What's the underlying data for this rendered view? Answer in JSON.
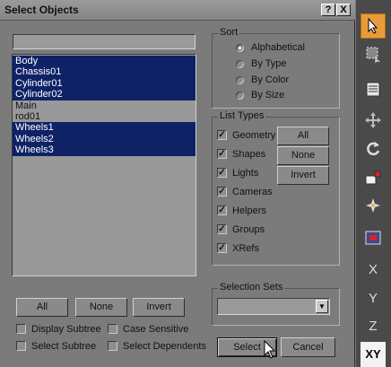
{
  "dialog": {
    "title": "Select Objects",
    "help_button": "?",
    "close_button": "X"
  },
  "list": {
    "filter_value": "",
    "items": [
      {
        "label": "Body",
        "selected": true
      },
      {
        "label": "Chassis01",
        "selected": true
      },
      {
        "label": "Cylinder01",
        "selected": true
      },
      {
        "label": "Cylinder02",
        "selected": true
      },
      {
        "label": "Main",
        "selected": false
      },
      {
        "label": "rod01",
        "selected": false
      },
      {
        "label": "Wheels1",
        "selected": true
      },
      {
        "label": "Wheels2",
        "selected": true
      },
      {
        "label": "Wheels3",
        "selected": true
      }
    ]
  },
  "sort": {
    "title": "Sort",
    "options": [
      {
        "label": "Alphabetical",
        "checked": true
      },
      {
        "label": "By Type",
        "checked": false
      },
      {
        "label": "By Color",
        "checked": false
      },
      {
        "label": "By Size",
        "checked": false
      }
    ]
  },
  "list_types": {
    "title": "List Types",
    "items": [
      {
        "label": "Geometry",
        "checked": true
      },
      {
        "label": "Shapes",
        "checked": true
      },
      {
        "label": "Lights",
        "checked": true
      },
      {
        "label": "Cameras",
        "checked": true
      },
      {
        "label": "Helpers",
        "checked": true
      },
      {
        "label": "Groups",
        "checked": true
      },
      {
        "label": "XRefs",
        "checked": true
      }
    ],
    "all_button": "All",
    "none_button": "None",
    "invert_button": "Invert"
  },
  "selection_sets": {
    "title": "Selection Sets",
    "value": ""
  },
  "bottom": {
    "all_button": "All",
    "none_button": "None",
    "invert_button": "Invert",
    "display_subtree": {
      "label": "Display Subtree",
      "checked": false
    },
    "case_sensitive": {
      "label": "Case Sensitive",
      "checked": false
    },
    "select_subtree": {
      "label": "Select Subtree",
      "checked": false
    },
    "select_dependents": {
      "label": "Select Dependents",
      "checked": false
    },
    "select_button": "Select",
    "cancel_button": "Cancel"
  },
  "toolbar": {
    "tools": [
      "select-arrow-icon",
      "region-select-icon",
      "select-by-name-icon",
      "move-icon",
      "rotate-icon",
      "scale-icon",
      "pivot-icon",
      "mirror-icon"
    ],
    "axis_x": "X",
    "axis_y": "Y",
    "axis_z": "Z",
    "axis_xy": "XY"
  }
}
